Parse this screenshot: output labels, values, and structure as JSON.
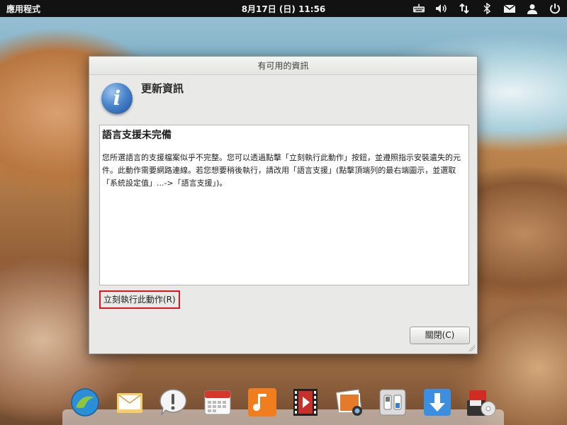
{
  "top_panel": {
    "apps_label": "應用程式",
    "clock": "8月17日 (日) 11:56",
    "tray_icons": [
      "keyboard-icon",
      "volume-icon",
      "network-icon",
      "bluetooth-icon",
      "mail-icon",
      "user-icon",
      "power-icon"
    ]
  },
  "dialog": {
    "title": "有可用的資訊",
    "heading": "更新資訊",
    "content_title": "語言支援未完備",
    "content_body": "您所選語言的支援檔案似乎不完整。您可以透過點擊「立刻執行此動作」按鈕，並遵照指示安裝遺失的元件。此動作需要網路連線。若您想要稍後執行，請改用「語言支援」(點擊頂端列的最右端圖示，並選取「系統設定值」...->「語言支援」)。",
    "action_label": "立刻執行此動作(R)",
    "close_label": "關閉(C)"
  },
  "dock": {
    "items": [
      "browser-icon",
      "mail-icon",
      "notification-icon",
      "calendar-icon",
      "music-icon",
      "video-icon",
      "photos-icon",
      "settings-icon",
      "software-center-icon",
      "backup-icon"
    ]
  },
  "colors": {
    "panel_bg": "#121212",
    "dialog_bg": "#e9e9e7",
    "highlight_border": "#e0141a",
    "info_icon_blue": "#3a74c2"
  }
}
